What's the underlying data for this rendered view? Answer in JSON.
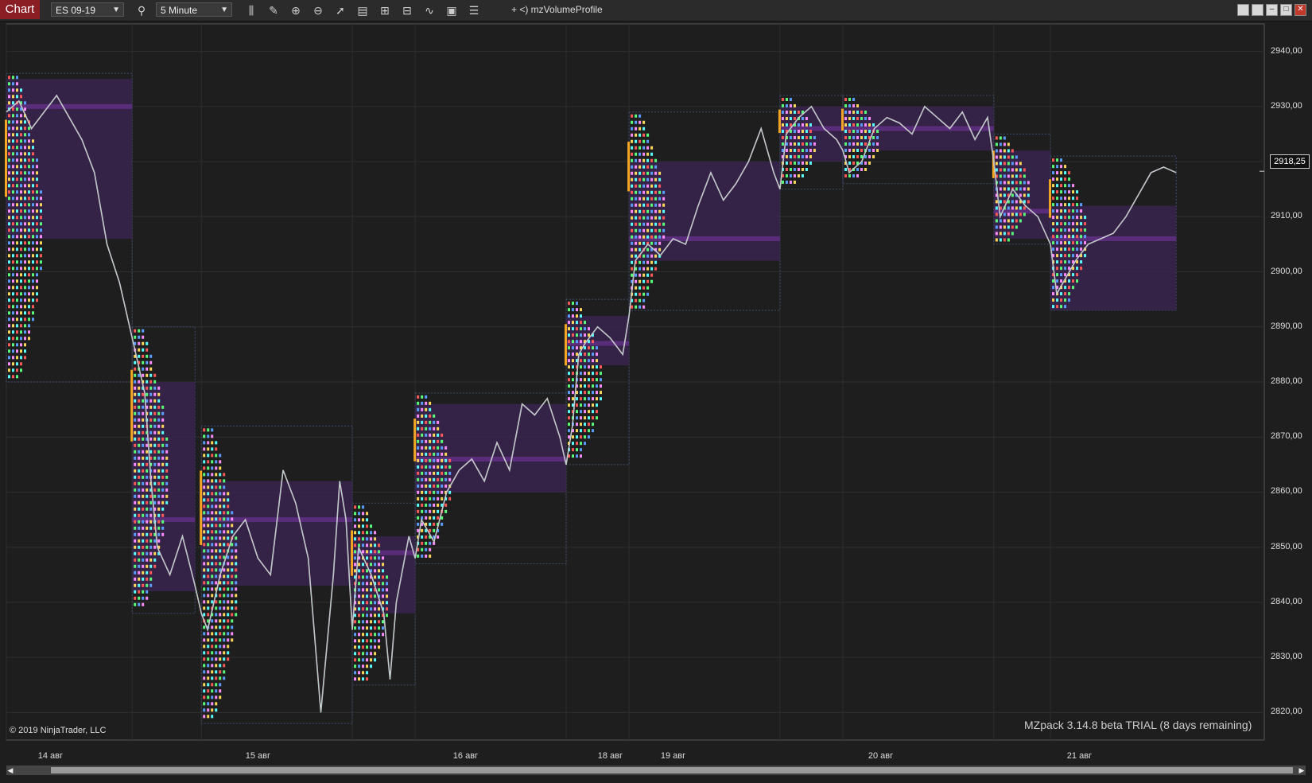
{
  "toolbar": {
    "tab_label": "Chart",
    "instrument": "ES 09-19",
    "interval": "5 Minute",
    "indicator": "+ <)  mzVolumeProfile",
    "icons": [
      "search-icon",
      "bar-type-icon",
      "draw-tool-icon",
      "zoom-in-icon",
      "zoom-out-icon",
      "pointer-icon",
      "data-box-icon",
      "properties-icon",
      "strategies-icon",
      "indicators-icon",
      "chart-trader-icon",
      "list-icon"
    ]
  },
  "window_buttons": [
    "tile-icon",
    "tile-icon",
    "minimize-icon",
    "maximize-icon",
    "close-icon"
  ],
  "price_axis": {
    "ticks": [
      "2940,00",
      "2930,00",
      "2920,00",
      "2910,00",
      "2900,00",
      "2890,00",
      "2880,00",
      "2870,00",
      "2860,00",
      "2850,00",
      "2840,00",
      "2830,00",
      "2820,00"
    ],
    "current_price": "2918,25"
  },
  "date_axis": {
    "ticks": [
      "14 авг",
      "15 авг",
      "16 авг",
      "18 авг",
      "19 авг",
      "20 авг",
      "21 авг"
    ]
  },
  "copyright": "© 2019 NinjaTrader, LLC",
  "trial_notice": "MZpack 3.14.8 beta TRIAL  (8 days remaining)",
  "colors": {
    "background": "#1e1e1e",
    "profile_fill": "#3a2450",
    "poc_line": "#5a2d7a",
    "open_marker": "#f5a623",
    "tab_red": "#8b1d24"
  },
  "chart_data": {
    "type": "line",
    "instrument": "ES 09-19",
    "ylim": [
      2815,
      2945
    ],
    "price_levels": [
      2940,
      2930,
      2920,
      2910,
      2900,
      2890,
      2880,
      2870,
      2860,
      2850,
      2840,
      2830,
      2820
    ],
    "sessions": [
      {
        "date": "14 авг",
        "start": 0.0,
        "end": 0.1,
        "high": 2936,
        "low": 2880,
        "va_high": 2935,
        "va_low": 2906,
        "poc": 2930
      },
      {
        "date": "14 авг",
        "start": 0.1,
        "end": 0.15,
        "high": 2890,
        "low": 2838,
        "va_high": 2880,
        "va_low": 2842,
        "poc": 2855
      },
      {
        "date": "15 авг",
        "start": 0.155,
        "end": 0.275,
        "high": 2872,
        "low": 2818,
        "va_high": 2862,
        "va_low": 2843,
        "poc": 2855
      },
      {
        "date": "15 авг",
        "start": 0.275,
        "end": 0.325,
        "high": 2858,
        "low": 2825,
        "va_high": 2852,
        "va_low": 2838,
        "poc": 2849
      },
      {
        "date": "16 авг",
        "start": 0.325,
        "end": 0.445,
        "high": 2878,
        "low": 2847,
        "va_high": 2876,
        "va_low": 2860,
        "poc": 2866
      },
      {
        "date": "16 авг",
        "start": 0.445,
        "end": 0.495,
        "high": 2895,
        "low": 2865,
        "va_high": 2892,
        "va_low": 2883,
        "poc": 2887
      },
      {
        "date": "19 авг",
        "start": 0.495,
        "end": 0.615,
        "high": 2929,
        "low": 2893,
        "va_high": 2920,
        "va_low": 2902,
        "poc": 2906
      },
      {
        "date": "19 авг",
        "start": 0.615,
        "end": 0.665,
        "high": 2932,
        "low": 2915,
        "va_high": 2930,
        "va_low": 2920,
        "poc": 2926
      },
      {
        "date": "20 авг",
        "start": 0.665,
        "end": 0.785,
        "high": 2932,
        "low": 2916,
        "va_high": 2930,
        "va_low": 2922,
        "poc": 2926
      },
      {
        "date": "20 авг",
        "start": 0.785,
        "end": 0.83,
        "high": 2925,
        "low": 2905,
        "va_high": 2922,
        "va_low": 2906,
        "poc": 2911
      },
      {
        "date": "21 авг",
        "start": 0.83,
        "end": 0.93,
        "high": 2921,
        "low": 2893,
        "va_high": 2912,
        "va_low": 2893,
        "poc": 2906
      }
    ],
    "price_path": [
      [
        0.0,
        2929
      ],
      [
        0.01,
        2931
      ],
      [
        0.02,
        2926
      ],
      [
        0.03,
        2929
      ],
      [
        0.04,
        2932
      ],
      [
        0.05,
        2928
      ],
      [
        0.06,
        2924
      ],
      [
        0.07,
        2918
      ],
      [
        0.08,
        2905
      ],
      [
        0.09,
        2898
      ],
      [
        0.1,
        2888
      ],
      [
        0.11,
        2878
      ],
      [
        0.115,
        2862
      ],
      [
        0.12,
        2850
      ],
      [
        0.13,
        2845
      ],
      [
        0.14,
        2852
      ],
      [
        0.15,
        2843
      ],
      [
        0.155,
        2838
      ],
      [
        0.16,
        2835
      ],
      [
        0.17,
        2845
      ],
      [
        0.18,
        2852
      ],
      [
        0.19,
        2855
      ],
      [
        0.2,
        2848
      ],
      [
        0.21,
        2845
      ],
      [
        0.22,
        2864
      ],
      [
        0.23,
        2858
      ],
      [
        0.24,
        2848
      ],
      [
        0.25,
        2820
      ],
      [
        0.26,
        2845
      ],
      [
        0.265,
        2862
      ],
      [
        0.27,
        2855
      ],
      [
        0.275,
        2835
      ],
      [
        0.28,
        2850
      ],
      [
        0.29,
        2845
      ],
      [
        0.3,
        2838
      ],
      [
        0.305,
        2826
      ],
      [
        0.31,
        2840
      ],
      [
        0.32,
        2852
      ],
      [
        0.325,
        2848
      ],
      [
        0.33,
        2855
      ],
      [
        0.34,
        2851
      ],
      [
        0.35,
        2860
      ],
      [
        0.36,
        2864
      ],
      [
        0.37,
        2866
      ],
      [
        0.38,
        2862
      ],
      [
        0.39,
        2869
      ],
      [
        0.4,
        2864
      ],
      [
        0.41,
        2876
      ],
      [
        0.42,
        2874
      ],
      [
        0.43,
        2877
      ],
      [
        0.44,
        2870
      ],
      [
        0.445,
        2865
      ],
      [
        0.45,
        2872
      ],
      [
        0.455,
        2885
      ],
      [
        0.46,
        2887
      ],
      [
        0.47,
        2890
      ],
      [
        0.48,
        2888
      ],
      [
        0.49,
        2885
      ],
      [
        0.495,
        2892
      ],
      [
        0.5,
        2902
      ],
      [
        0.51,
        2905
      ],
      [
        0.52,
        2903
      ],
      [
        0.53,
        2906
      ],
      [
        0.54,
        2905
      ],
      [
        0.55,
        2912
      ],
      [
        0.56,
        2918
      ],
      [
        0.57,
        2913
      ],
      [
        0.58,
        2916
      ],
      [
        0.59,
        2920
      ],
      [
        0.6,
        2926
      ],
      [
        0.61,
        2918
      ],
      [
        0.615,
        2915
      ],
      [
        0.62,
        2925
      ],
      [
        0.63,
        2928
      ],
      [
        0.64,
        2930
      ],
      [
        0.65,
        2926
      ],
      [
        0.66,
        2924
      ],
      [
        0.665,
        2922
      ],
      [
        0.67,
        2918
      ],
      [
        0.68,
        2920
      ],
      [
        0.69,
        2926
      ],
      [
        0.7,
        2928
      ],
      [
        0.71,
        2927
      ],
      [
        0.72,
        2925
      ],
      [
        0.73,
        2930
      ],
      [
        0.74,
        2928
      ],
      [
        0.75,
        2926
      ],
      [
        0.76,
        2929
      ],
      [
        0.77,
        2924
      ],
      [
        0.78,
        2928
      ],
      [
        0.785,
        2920
      ],
      [
        0.79,
        2910
      ],
      [
        0.8,
        2915
      ],
      [
        0.81,
        2912
      ],
      [
        0.82,
        2910
      ],
      [
        0.83,
        2905
      ],
      [
        0.835,
        2896
      ],
      [
        0.84,
        2898
      ],
      [
        0.85,
        2902
      ],
      [
        0.86,
        2905
      ],
      [
        0.87,
        2906
      ],
      [
        0.88,
        2907
      ],
      [
        0.89,
        2910
      ],
      [
        0.9,
        2914
      ],
      [
        0.91,
        2918
      ],
      [
        0.92,
        2919
      ],
      [
        0.93,
        2918
      ]
    ]
  }
}
